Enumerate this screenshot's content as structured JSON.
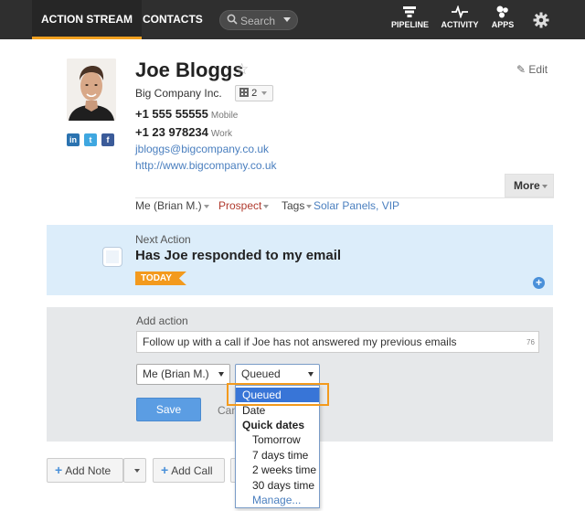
{
  "nav": {
    "tabs": [
      {
        "label": "ACTION STREAM",
        "active": true
      },
      {
        "label": "CONTACTS",
        "active": false
      }
    ],
    "search_label": "Search",
    "icons": [
      {
        "label": "PIPELINE",
        "icon": "pipeline-icon"
      },
      {
        "label": "ACTIVITY",
        "icon": "activity-icon"
      },
      {
        "label": "APPS",
        "icon": "apps-icon"
      }
    ],
    "settings_icon": "gear-icon"
  },
  "contact": {
    "name": "Joe Bloggs",
    "company": "Big Company Inc.",
    "company_count": "2",
    "phones": [
      {
        "number": "+1 555 55555",
        "type": "Mobile"
      },
      {
        "number": "+1 23 978234",
        "type": "Work"
      }
    ],
    "email": "jbloggs@bigcompany.co.uk",
    "website": "http://www.bigcompany.co.uk",
    "edit_label": "Edit",
    "more_label": "More",
    "social": [
      "in",
      "t",
      "f"
    ]
  },
  "meta": {
    "owner": "Me (Brian M.)",
    "status": "Prospect",
    "tags_label": "Tags",
    "tags": "Solar Panels, VIP"
  },
  "next_action": {
    "label": "Next Action",
    "title": "Has Joe responded to my email",
    "badge": "TODAY"
  },
  "add_action": {
    "label": "Add action",
    "input_value": "Follow up with a call if Joe has not answered my previous emails",
    "char_count": "76",
    "assignee": "Me (Brian M.)",
    "timing": "Queued",
    "save_label": "Save",
    "cancel_label": "Can"
  },
  "dropdown": {
    "selected": "Queued",
    "date": "Date",
    "group": "Quick dates",
    "options": [
      "Tomorrow",
      "7 days time",
      "2 weeks time",
      "30 days time"
    ],
    "manage": "Manage..."
  },
  "bottom": {
    "add_note": "Add Note",
    "add_call": "Add Call"
  },
  "colors": {
    "nav_bg": "#2f2f2f",
    "accent": "#f39a1d",
    "link": "#4a7fbf",
    "panel_blue": "#dcedfa",
    "prospect": "#b03a2e"
  }
}
